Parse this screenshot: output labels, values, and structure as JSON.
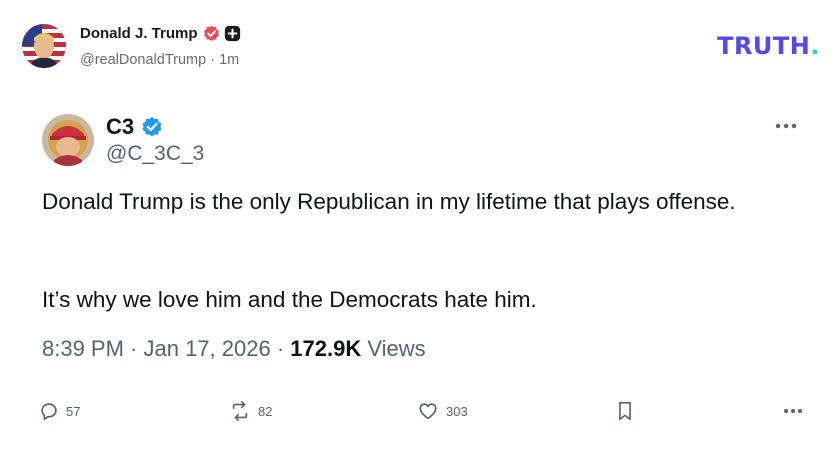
{
  "truth_post": {
    "author_name": "Donald J. Trump",
    "handle": "@realDonaldTrump",
    "separator": " · ",
    "time_ago": "1m",
    "logo_text": "TRUTH",
    "logo_dot": ".",
    "colors": {
      "logo": "#5448ee",
      "logo_dot": "#17e2c7",
      "verified_badge": "#e64c5d"
    }
  },
  "embedded_post": {
    "display_name": "C3",
    "handle": "@C_3C_3",
    "paragraphs": [
      "Donald Trump is the only Republican in my lifetime that plays offense.",
      "It’s why we love him and the Democrats hate him."
    ],
    "time": "8:39 PM",
    "date": "Jan 17, 2026",
    "meta_separator": " · ",
    "views_count": "172.9K",
    "views_label": "Views",
    "actions": {
      "replies": "57",
      "reposts": "82",
      "likes": "303"
    },
    "colors": {
      "verified": "#1d9bf0",
      "text": "#0f1419",
      "secondary": "#536471"
    }
  }
}
